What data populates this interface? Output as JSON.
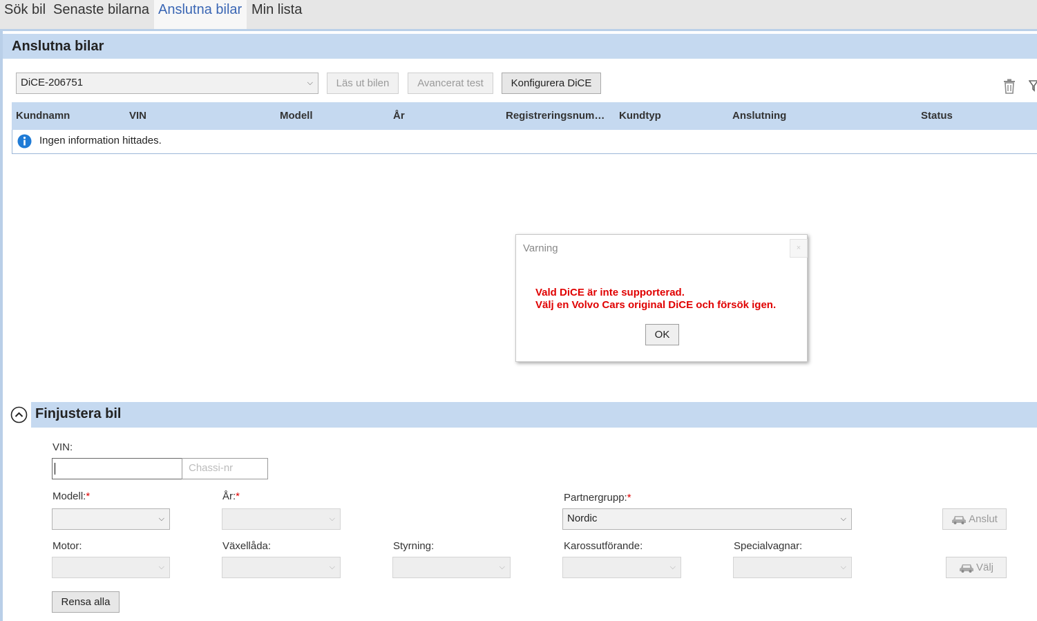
{
  "tabs": [
    {
      "label": "Sök bil"
    },
    {
      "label": "Senaste bilarna"
    },
    {
      "label": "Anslutna bilar"
    },
    {
      "label": "Min lista"
    }
  ],
  "connected": {
    "title": "Anslutna bilar",
    "dice_selected": "DiCE-206751",
    "read_label": "Läs ut bilen",
    "advanced_label": "Avancerat test",
    "configure_label": "Konfigurera DiCE",
    "columns": [
      "Kundnamn",
      "VIN",
      "Modell",
      "År",
      "Registreringsnum…",
      "Kundtyp",
      "Anslutning",
      "Status"
    ],
    "empty_message": "Ingen information hittades."
  },
  "modal": {
    "title": "Varning",
    "close_glyph": "×",
    "line1": "Vald DiCE är inte supporterad.",
    "line2": "Välj en Volvo Cars original DiCE och försök igen.",
    "ok_label": "OK"
  },
  "finetune": {
    "title": "Finjustera bil",
    "vin_label": "VIN:",
    "vin_value": "",
    "chassis_placeholder": "Chassi-nr",
    "model_label": "Modell:",
    "year_label": "År:",
    "partner_label": "Partnergrupp:",
    "partner_value": "Nordic",
    "required_mark": "*",
    "connect_label": "Anslut",
    "engine_label": "Motor:",
    "gearbox_label": "Växellåda:",
    "steering_label": "Styrning:",
    "body_label": "Karossutförande:",
    "special_label": "Specialvagnar:",
    "choose_label": "Välj",
    "clear_label": "Rensa alla"
  },
  "colors": {
    "header_bg": "#c5d9f0",
    "active_tab_text": "#3a66b4",
    "warning_text": "#e00000"
  }
}
